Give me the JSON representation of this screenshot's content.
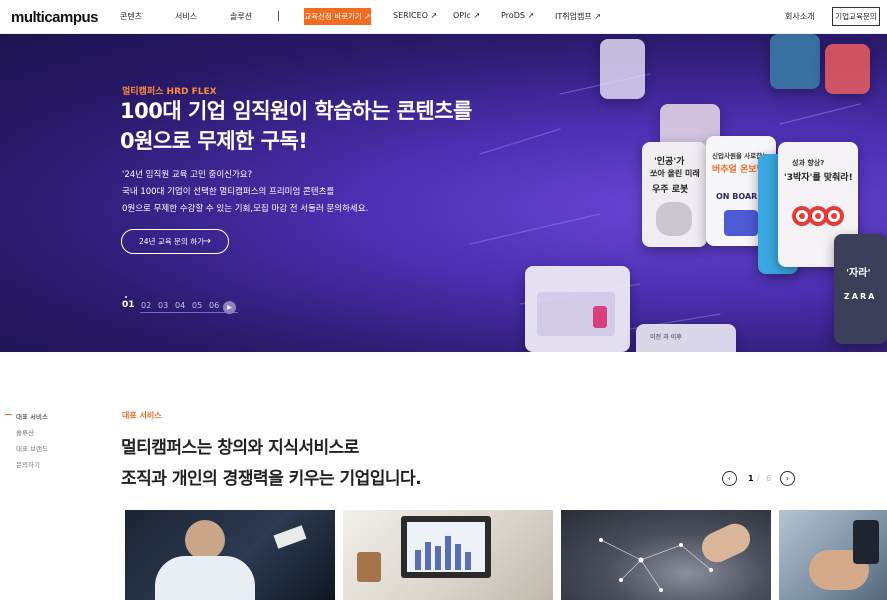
{
  "header": {
    "logo": "multicampus",
    "nav": [
      "콘텐츠",
      "서비스",
      "솔루션"
    ],
    "cta": "교육신청 바로가기 ↗",
    "links": [
      "SERICEO ↗",
      "OPIc ↗",
      "ProDS ↗",
      "IT취업캠프 ↗"
    ],
    "about": "회사소개",
    "inquiry": "기업교육문의"
  },
  "hero": {
    "kicker": "멀티캠퍼스 HRD FLEX",
    "title_line1": "100대 기업 임직원이 학습하는 콘텐츠를",
    "title_line2": "0원으로 무제한 구독!",
    "desc_line1": "'24년 임직원 교육 고민 중이신가요?",
    "desc_line2": "국내 100대 기업이 선택한 멀티캠퍼스의 프리미엄 콘텐츠를",
    "desc_line3": "0원으로 무제한 수강할 수 있는 기회,모집 마감 전 서둘러 문의하세요.",
    "button": "24년 교육 문의 하기",
    "button_arrow": "→",
    "pages": [
      "01",
      "02",
      "03",
      "04",
      "05",
      "06"
    ],
    "play": "▶",
    "cards": {
      "c1a": "'인공'가",
      "c1b": "쏘아 올린 미래",
      "c1c": "우주 로봇",
      "c2a": "신입사원을 사로잡는",
      "c2b": "버추얼 온보딩",
      "c2c": "ON BOARDING",
      "c3a": "성과 향상?",
      "c3b": "'3박자'를 맞춰라!",
      "c4a": "'자라'",
      "c4b": "ZARA",
      "c5": "이전 과 이후"
    }
  },
  "section": {
    "side": [
      "대표 서비스",
      "솔루션",
      "대표 브랜드",
      "문의하기"
    ],
    "kicker": "대표 서비스",
    "title_line1": "멀티캠퍼스는 창의와 지식서비스로",
    "title_line2": "조직과 개인의 경쟁력을 키우는 기업입니다.",
    "prev": "‹",
    "next": "›",
    "current": "1",
    "slash": "/",
    "total": "6"
  }
}
